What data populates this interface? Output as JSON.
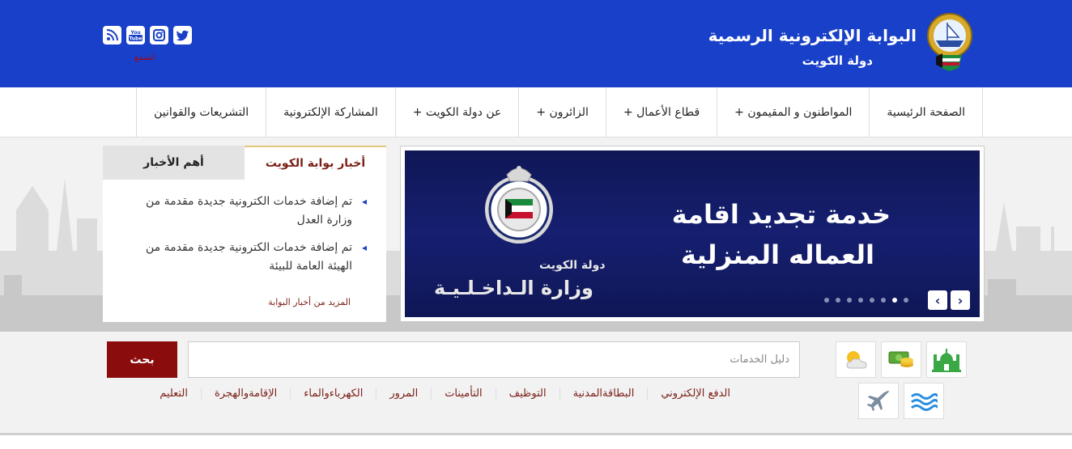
{
  "header": {
    "title": "البوابة الإلكترونية الرسمية",
    "subtitle": "دولة  الكويت",
    "listen_label": "استمع",
    "social": [
      {
        "icon": "rss-icon"
      },
      {
        "icon": "youtube-icon",
        "text": "You Tube"
      },
      {
        "icon": "instagram-icon"
      },
      {
        "icon": "twitter-icon"
      }
    ]
  },
  "nav": {
    "items": [
      {
        "label": "الصفحة الرئيسية"
      },
      {
        "label": "المواطنون و المقيمون +"
      },
      {
        "label": "قطاع الأعمال +"
      },
      {
        "label": "الزائرون +"
      },
      {
        "label": "عن دولة الكويت +"
      },
      {
        "label": "المشاركة الإلكترونية"
      },
      {
        "label": "التشريعات والقوانين"
      }
    ]
  },
  "slider": {
    "line1": "خدمة تجديد اقامة",
    "line2": "العماله المنزلية",
    "ministry_small": "دولة الكويت",
    "ministry_large": "وزارة الـداخـلـيـة",
    "dot_count": 8,
    "active_dot": 6,
    "prev_label": "‹",
    "next_label": "›"
  },
  "news": {
    "tab_active": "أخبار بوابة الكويت",
    "tab_inactive": "أهم الأخبار",
    "items": [
      "تم إضافة خدمات الكترونية جديدة مقدمة من وزارة العدل",
      "تم إضافة خدمات الكترونية جديدة مقدمة من الهيئة العامة للبيئة"
    ],
    "more": "المزيد من أخبار البوابة"
  },
  "search": {
    "button": "بحث",
    "placeholder": "دليل الخدمات",
    "quick_links": [
      "الدفع الإلكتروني",
      "البطاقةالمدنية",
      "التوظيف",
      "التأمينات",
      "المرور",
      "الكهرباءوالماء",
      "الإقامةوالهجرة",
      "التعليم"
    ]
  },
  "services": [
    "mosque-icon",
    "money-icon",
    "weather-icon",
    "water-icon",
    "plane-icon"
  ],
  "colors": {
    "header_blue": "#1840c8",
    "accent_red": "#8a0c0c",
    "link_maroon": "#7a1f16",
    "slide_navy": "#161f70"
  }
}
